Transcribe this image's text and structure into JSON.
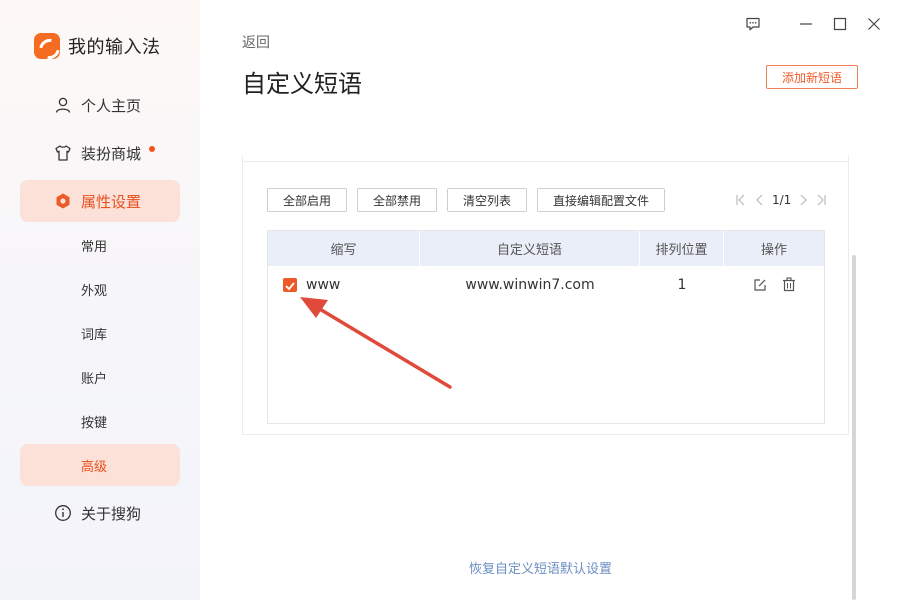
{
  "app": {
    "title": "我的输入法"
  },
  "sidebar": {
    "items": [
      {
        "label": "个人主页",
        "icon": "user-icon"
      },
      {
        "label": "装扮商城",
        "icon": "shirt-icon",
        "has_badge": true
      },
      {
        "label": "属性设置",
        "icon": "hexagon-settings-icon",
        "active": true
      },
      {
        "label": "关于搜狗",
        "icon": "info-icon"
      }
    ],
    "subitems": [
      {
        "label": "常用"
      },
      {
        "label": "外观"
      },
      {
        "label": "词库"
      },
      {
        "label": "账户"
      },
      {
        "label": "按键"
      },
      {
        "label": "高级",
        "active": true
      }
    ]
  },
  "header": {
    "back_label": "返回",
    "title": "自定义短语",
    "add_button": "添加新短语"
  },
  "toolbar": {
    "enable_all": "全部启用",
    "disable_all": "全部禁用",
    "clear_list": "清空列表",
    "edit_config": "直接编辑配置文件"
  },
  "pagination": {
    "text": "1/1"
  },
  "table": {
    "columns": [
      "缩写",
      "自定义短语",
      "排列位置",
      "操作"
    ],
    "rows": [
      {
        "abbr": "www",
        "phrase": "www.winwin7.com",
        "position": "1",
        "checked": true
      }
    ]
  },
  "footer": {
    "restore_label": "恢复自定义短语默认设置"
  },
  "colors": {
    "accent": "#ec5a2a",
    "active_bg": "#fbe1d8",
    "link": "#6b8fc2",
    "header_bg": "#eaeef8"
  }
}
